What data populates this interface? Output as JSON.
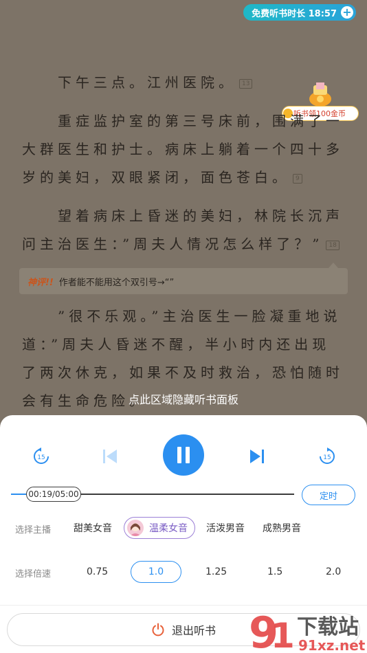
{
  "listen_timer": {
    "label": "免费听书时长 18:57",
    "plus": "+"
  },
  "coin_badge": {
    "label": "听书领100金币"
  },
  "content": {
    "p1": "下午三点。江州医院。",
    "p1_comments": "13",
    "p2": "重症监护室的第三号床前，围满了一大群医生和护士。病床上躺着一个四十多岁的美妇，双眼紧闭，面色苍白。",
    "p2_comments": "9",
    "p3": "望着病床上昏迷的美妇，林院长沉声问主治医生：”周夫人情况怎么样了？”",
    "p3_comments": "18",
    "review_tag": "神评!!",
    "review_text": "作者能不能用这个双引号→“”",
    "p4": "”很不乐观。”主治医生一脸凝重地说道：”周夫人昏迷不醒，半小时内还出现了两次休克，如果不及时救治，恐怕随时会有生命危险。"
  },
  "hide_hint": "点此区域隐藏听书面板",
  "player": {
    "rewind_label": "15",
    "forward_label": "15",
    "progress_text": "00:19/05:00",
    "progress_fraction": 0.063,
    "timer_button": "定时",
    "voice_label": "选择主播",
    "voices": [
      "甜美女音",
      "温柔女音",
      "活泼男音",
      "成熟男音"
    ],
    "selected_voice": "温柔女音",
    "speed_label": "选择倍速",
    "speeds": [
      "0.75",
      "1.0",
      "1.25",
      "1.5",
      "2.0"
    ],
    "selected_speed": "1.0",
    "exit_label": "退出听书"
  },
  "watermark": {
    "title": "下载站",
    "url": "91xz.net"
  },
  "colors": {
    "accent": "#2b8ff0",
    "page_bg": "#7d7367",
    "voice_selected": "#9b7fd6"
  }
}
